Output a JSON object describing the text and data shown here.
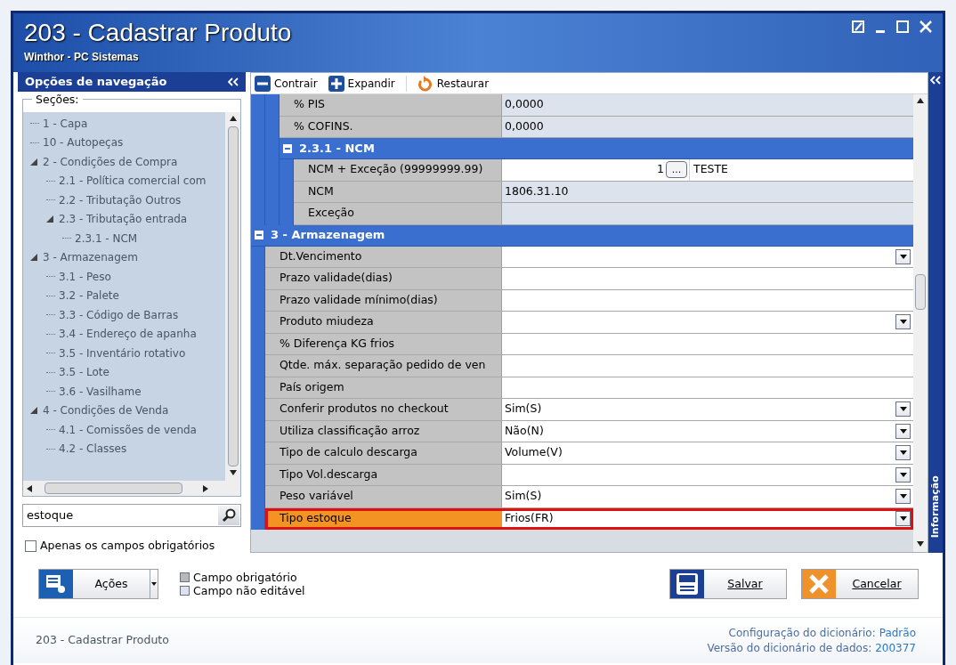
{
  "window": {
    "title": "203 - Cadastrar  Produto",
    "subtitle": "Winthor - PC Sistemas"
  },
  "nav": {
    "title": "Opções de navegação",
    "sections_label": "Seções:",
    "tree": [
      {
        "label": "1 - Capa"
      },
      {
        "label": "10 - Autopeças"
      },
      {
        "label": "2 - Condições de Compra",
        "expanded": true,
        "children": [
          {
            "label": "2.1 - Política comercial com"
          },
          {
            "label": "2.2 - Tributação Outros"
          },
          {
            "label": "2.3 - Tributação entrada",
            "expanded": true,
            "children": [
              {
                "label": "2.3.1 - NCM"
              }
            ]
          }
        ]
      },
      {
        "label": "3 - Armazenagem",
        "expanded": true,
        "children": [
          {
            "label": "3.1 - Peso"
          },
          {
            "label": "3.2 - Palete"
          },
          {
            "label": "3.3 - Código de Barras"
          },
          {
            "label": "3.4 - Endereço de apanha"
          },
          {
            "label": "3.5 - Inventário rotativo"
          },
          {
            "label": "3.5 - Lote"
          },
          {
            "label": "3.6 - Vasilhame"
          }
        ]
      },
      {
        "label": "4 - Condições de Venda",
        "expanded": true,
        "children": [
          {
            "label": "4.1 - Comissões de venda"
          },
          {
            "label": "4.2 - Classes"
          }
        ]
      }
    ],
    "search": {
      "value": "estoque"
    },
    "filter": {
      "label": "Apenas os campos obrigatórios",
      "checked": false
    }
  },
  "toolbar": [
    {
      "label": "Contrair",
      "kind": "collapse"
    },
    {
      "label": "Expandir",
      "kind": "expand"
    },
    {
      "label": "Restaurar",
      "kind": "restore"
    }
  ],
  "grid": {
    "groups": [
      {
        "children": [
          {
            "children": [
              {
                "label": "% PIS",
                "value": "0,0000",
                "kind": "text",
                "editable": false,
                "selected": false
              },
              {
                "label": "% COFINS.",
                "value": "0,0000",
                "kind": "text",
                "editable": false,
                "selected": false
              },
              {
                "title": "2.3.1 - NCM",
                "expanded": true,
                "children": [
                  {
                    "label": "NCM + Exceção (99999999.99)",
                    "code": "1",
                    "button_label": "...",
                    "value": "TESTE",
                    "kind": "lookup",
                    "editable": true,
                    "selected": false
                  },
                  {
                    "label": "NCM",
                    "value": "1806.31.10",
                    "kind": "text",
                    "editable": false,
                    "selected": false
                  },
                  {
                    "label": "Exceção",
                    "kind": "text",
                    "editable": false,
                    "selected": false
                  }
                ]
              }
            ]
          }
        ]
      },
      {
        "title": "3 - Armazenagem",
        "expanded": true,
        "children": [
          {
            "label": "Dt.Vencimento",
            "kind": "dropdown",
            "editable": true,
            "selected": false
          },
          {
            "label": "Prazo validade(dias)",
            "kind": "text",
            "editable": true,
            "selected": false
          },
          {
            "label": "Prazo validade mínimo(dias)",
            "kind": "text",
            "editable": true,
            "selected": false
          },
          {
            "label": "Produto miudeza",
            "kind": "dropdown",
            "editable": true,
            "selected": false
          },
          {
            "label": "% Diferença KG frios",
            "kind": "text",
            "editable": true,
            "selected": false
          },
          {
            "label": "Qtde. máx. separação pedido de ven",
            "kind": "text",
            "editable": true,
            "selected": false
          },
          {
            "label": "País origem",
            "kind": "text",
            "editable": true,
            "selected": false
          },
          {
            "label": "Conferir produtos no checkout",
            "value": "Sim(S)",
            "kind": "dropdown",
            "editable": true,
            "selected": false
          },
          {
            "label": "Utiliza classificação arroz",
            "value": "Não(N)",
            "kind": "dropdown",
            "editable": true,
            "selected": false
          },
          {
            "label": "Tipo de calculo descarga",
            "value": "Volume(V)",
            "kind": "dropdown",
            "editable": true,
            "selected": false
          },
          {
            "label": "Tipo Vol.descarga",
            "kind": "dropdown",
            "editable": true,
            "selected": false
          },
          {
            "label": "Peso variável",
            "value": "Sim(S)",
            "kind": "dropdown",
            "editable": true,
            "selected": false
          },
          {
            "label": "Tipo estoque",
            "value": "Frios(FR)",
            "kind": "dropdown",
            "editable": true,
            "selected": true
          }
        ]
      }
    ]
  },
  "side_tab": "Informação",
  "actions": {
    "label": "Ações"
  },
  "legend": [
    {
      "label": "Campo obrigatório",
      "color": "#b8b8b8"
    },
    {
      "label": "Campo não editável",
      "color": "#dde3ec"
    }
  ],
  "buttons": [
    {
      "label": "Salvar",
      "kind": "save"
    },
    {
      "label": "Cancelar",
      "kind": "cancel"
    }
  ],
  "status": {
    "left": "203 - Cadastrar  Produto",
    "info": [
      {
        "label": "Configuração do dicionário:",
        "value": "Padrão"
      },
      {
        "label": "Versão do dicionário de dados:",
        "value": "200377"
      }
    ]
  }
}
